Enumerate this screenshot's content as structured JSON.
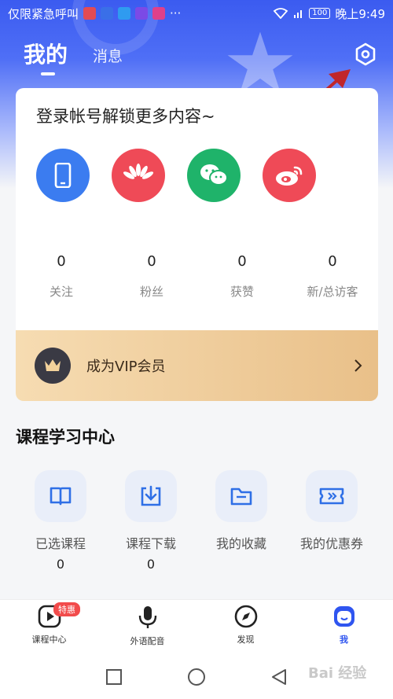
{
  "status_bar": {
    "left_text": "仅限紧急呼叫",
    "overflow": "···",
    "battery": "100",
    "time": "晚上9:49"
  },
  "top_tabs": {
    "me": "我的",
    "messages": "消息"
  },
  "icons": {
    "settings": "settings-hex-icon"
  },
  "card": {
    "login_prompt": "登录帐号解锁更多内容~",
    "social_logins": [
      {
        "name": "phone",
        "color": "#3b7cf0"
      },
      {
        "name": "huawei",
        "color": "#ef4a57"
      },
      {
        "name": "wechat",
        "color": "#1fb36a"
      },
      {
        "name": "weibo",
        "color": "#ef4a57"
      }
    ],
    "stats": [
      {
        "value": "0",
        "label": "关注"
      },
      {
        "value": "0",
        "label": "粉丝"
      },
      {
        "value": "0",
        "label": "获赞"
      },
      {
        "value": "0",
        "label": "新/总访客"
      }
    ],
    "vip_label": "成为VIP会员"
  },
  "course_section": {
    "title": "课程学习中心",
    "items": [
      {
        "label": "已选课程",
        "value": "0",
        "icon": "book-icon"
      },
      {
        "label": "课程下载",
        "value": "0",
        "icon": "download-icon"
      },
      {
        "label": "我的收藏",
        "value": "",
        "icon": "folder-icon"
      },
      {
        "label": "我的优惠券",
        "value": "",
        "icon": "coupon-icon"
      }
    ]
  },
  "bottom_nav": {
    "items": [
      {
        "label": "课程中心",
        "badge": "特惠"
      },
      {
        "label": "外语配音"
      },
      {
        "label": "发现"
      },
      {
        "label": "我"
      }
    ],
    "accent": "#2f55f0"
  },
  "watermark": "Bai 经验"
}
